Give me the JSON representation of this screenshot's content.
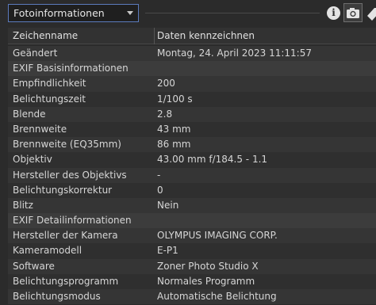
{
  "panel": {
    "selector_value": "Fotoinformationen"
  },
  "icons": {
    "info": "info-icon",
    "camera": "camera-icon",
    "tag": "tag-icon",
    "info_glyph": "i"
  },
  "columns": {
    "name": "Zeichenname",
    "value": "Daten kennzeichnen"
  },
  "rows": [
    {
      "name": "Geändert",
      "value": "Montag, 24. April 2023 11:11:57"
    },
    {
      "name": "EXIF Basisinformationen",
      "value": "",
      "section": true
    },
    {
      "name": "Empfindlichkeit",
      "value": "200"
    },
    {
      "name": "Belichtungszeit",
      "value": "1/100 s"
    },
    {
      "name": "Blende",
      "value": "2.8"
    },
    {
      "name": "Brennweite",
      "value": "43 mm"
    },
    {
      "name": "Brennweite (EQ35mm)",
      "value": "86 mm"
    },
    {
      "name": "Objektiv",
      "value": "43.00 mm f/184.5 - 1.1"
    },
    {
      "name": "Hersteller des Objektivs",
      "value": "-"
    },
    {
      "name": "Belichtungskorrektur",
      "value": "0"
    },
    {
      "name": "Blitz",
      "value": "Nein"
    },
    {
      "name": "EXIF Detailinformationen",
      "value": "",
      "section": true
    },
    {
      "name": "Hersteller der Kamera",
      "value": "OLYMPUS IMAGING CORP."
    },
    {
      "name": "Kameramodell",
      "value": "E-P1"
    },
    {
      "name": "Software",
      "value": "Zoner Photo Studio X"
    },
    {
      "name": "Belichtungsprogramm",
      "value": "Normales Programm"
    },
    {
      "name": "Belichtungsmodus",
      "value": "Automatische Belichtung"
    }
  ],
  "colors": {
    "background": "#2b2b2b",
    "dropdown_border": "#5b7bbd",
    "text": "#d6d6d6"
  }
}
